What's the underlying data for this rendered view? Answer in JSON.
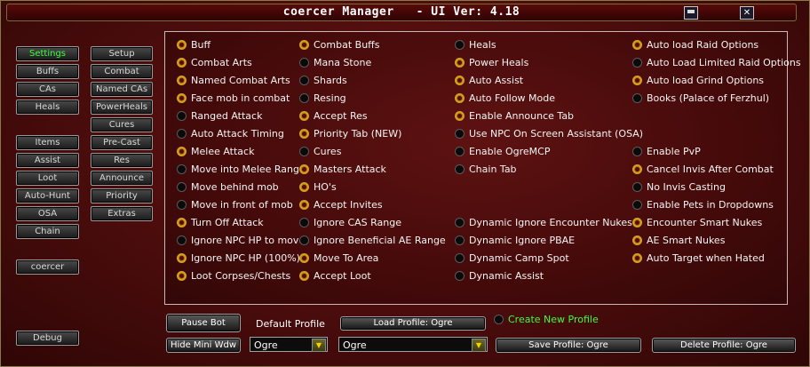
{
  "window": {
    "title": "coercer Manager   - UI Ver: 4.18",
    "minimize_icon": "minimize-icon",
    "close_icon": "close-icon",
    "close_glyph": "✕"
  },
  "nav": {
    "col1": [
      "Settings",
      "Buffs",
      "CAs",
      "Heals",
      "Items",
      "Assist",
      "Loot",
      "Auto-Hunt",
      "OSA",
      "Chain",
      "coercer",
      "Debug"
    ],
    "col2": [
      "Setup",
      "Combat",
      "Named CAs",
      "PowerHeals",
      "Cures",
      "Pre-Cast",
      "Res",
      "Announce",
      "Priority",
      "Extras"
    ]
  },
  "options": {
    "col1": [
      {
        "label": "Buff",
        "on": true
      },
      {
        "label": "Combat Arts",
        "on": true
      },
      {
        "label": "Named Combat Arts",
        "on": true
      },
      {
        "label": "Face mob in combat",
        "on": true
      },
      {
        "label": "Ranged Attack",
        "on": false
      },
      {
        "label": "Auto Attack Timing",
        "on": false
      },
      {
        "label": "Melee Attack",
        "on": true
      },
      {
        "label": "Move into Melee Range",
        "on": false
      },
      {
        "label": "Move behind mob",
        "on": false
      },
      {
        "label": "Move in front of mob",
        "on": false
      },
      {
        "label": "Turn Off Attack",
        "on": true
      },
      {
        "label": "Ignore NPC HP to move",
        "on": false
      },
      {
        "label": "Ignore NPC HP (100%)",
        "on": true
      },
      {
        "label": "Loot Corpses/Chests",
        "on": true
      }
    ],
    "col2": [
      {
        "label": "Combat Buffs",
        "on": true
      },
      {
        "label": "Mana Stone",
        "on": false
      },
      {
        "label": "Shards",
        "on": false
      },
      {
        "label": "Resing",
        "on": false
      },
      {
        "label": "Accept Res",
        "on": true
      },
      {
        "label": "Priority Tab (NEW)",
        "on": true
      },
      {
        "label": "Cures",
        "on": false
      },
      {
        "label": "Masters Attack",
        "on": true
      },
      {
        "label": "HO's",
        "on": true
      },
      {
        "label": "Accept Invites",
        "on": true
      },
      {
        "label": "Ignore CAS Range",
        "on": false
      },
      {
        "label": "Ignore Beneficial AE Range",
        "on": false
      },
      {
        "label": "Move To Area",
        "on": true
      },
      {
        "label": "Accept Loot",
        "on": true
      }
    ],
    "col3": [
      {
        "label": "Heals",
        "on": false,
        "row": 0
      },
      {
        "label": "Power Heals",
        "on": true,
        "row": 1
      },
      {
        "label": "Auto Assist",
        "on": true,
        "row": 2
      },
      {
        "label": "Auto Follow Mode",
        "on": true,
        "row": 3
      },
      {
        "label": "Enable Announce Tab",
        "on": true,
        "row": 4
      },
      {
        "label": "Use NPC On Screen Assistant (OSA)",
        "on": false,
        "row": 5
      },
      {
        "label": "Enable OgreMCP",
        "on": false,
        "row": 6
      },
      {
        "label": "Chain Tab",
        "on": false,
        "row": 7
      },
      {
        "label": "Dynamic Ignore Encounter Nukes",
        "on": false,
        "row": 10
      },
      {
        "label": "Dynamic Ignore PBAE",
        "on": false,
        "row": 11
      },
      {
        "label": "Dynamic Camp Spot",
        "on": false,
        "row": 12
      },
      {
        "label": "Dynamic Assist",
        "on": false,
        "row": 13
      }
    ],
    "col4": [
      {
        "label": "Auto load Raid Options",
        "on": true,
        "row": 0
      },
      {
        "label": "Auto Load Limited Raid Options",
        "on": false,
        "row": 1
      },
      {
        "label": "Auto load Grind Options",
        "on": true,
        "row": 2
      },
      {
        "label": "Books (Palace of Ferzhul)",
        "on": false,
        "row": 3
      },
      {
        "label": "Enable PvP",
        "on": false,
        "row": 6
      },
      {
        "label": "Cancel Invis After Combat",
        "on": true,
        "row": 7
      },
      {
        "label": "No Invis Casting",
        "on": false,
        "row": 8
      },
      {
        "label": "Enable Pets in Dropdowns",
        "on": false,
        "row": 9
      },
      {
        "label": "Encounter Smart Nukes",
        "on": true,
        "row": 10
      },
      {
        "label": "AE Smart Nukes",
        "on": true,
        "row": 11
      },
      {
        "label": "Auto Target when Hated",
        "on": true,
        "row": 12
      }
    ]
  },
  "bottom": {
    "pause_bot": "Pause Bot",
    "hide_mini": "Hide Mini Wdw",
    "default_profile_label": "Default Profile",
    "load_profile": "Load Profile: Ogre",
    "create_new_profile": "Create New Profile",
    "default_profile_value": "Ogre",
    "profile_value": "Ogre",
    "save_profile": "Save Profile: Ogre",
    "delete_profile": "Delete Profile: Ogre",
    "dropdown_arrow": "▼"
  },
  "colors": {
    "active_text": "#3cff3c",
    "background": "#4a0c0c",
    "radio_on": "#e0b020"
  }
}
